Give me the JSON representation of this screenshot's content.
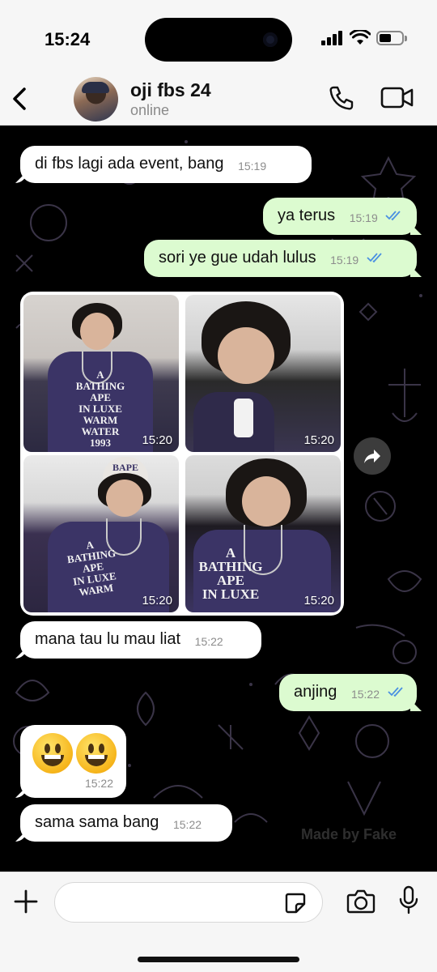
{
  "status_bar": {
    "time": "15:24",
    "battery_percent": 55
  },
  "header": {
    "back_icon": "chevron-left-icon",
    "contact_name": "oji fbs 24",
    "contact_status": "online",
    "call_icon": "phone-icon",
    "video_icon": "video-camera-icon"
  },
  "messages": [
    {
      "dir": "in",
      "text": "di fbs lagi ada event, bang",
      "time": "15:19"
    },
    {
      "dir": "out",
      "text": "ya terus",
      "time": "15:19",
      "read": true
    },
    {
      "dir": "out",
      "text": "sori ye gue udah lulus",
      "time": "15:19",
      "read": true
    },
    {
      "dir": "in",
      "type": "album",
      "photos": [
        {
          "time": "15:20",
          "shirt_text": "A\nBATHING\nAPE\nIN LUXE\nWARM\nWATER\n1993"
        },
        {
          "time": "15:20"
        },
        {
          "time": "15:20",
          "cap_text": "BAPE",
          "shirt_text": "A\nBATHING\nAPE\nIN LUXE\nWARM"
        },
        {
          "time": "15:20",
          "shirt_text": "A\nBATHING\nAPE\nIN LUXE"
        }
      ]
    },
    {
      "dir": "in",
      "text": "mana tau lu mau liat",
      "time": "15:22"
    },
    {
      "dir": "out",
      "text": "anjing",
      "time": "15:22",
      "read": true
    },
    {
      "dir": "in",
      "type": "emoji",
      "emoji": "😃😃",
      "time": "15:22"
    },
    {
      "dir": "in",
      "text": "sama sama bang",
      "time": "15:22"
    }
  ],
  "watermark": "Made by Fake",
  "input_bar": {
    "plus_icon": "plus-icon",
    "message_value": "",
    "sticker_icon": "sticker-icon",
    "camera_icon": "camera-icon",
    "mic_icon": "microphone-icon"
  },
  "colors": {
    "outgoing_bubble": "#dcfbd0",
    "incoming_bubble": "#ffffff",
    "read_tick": "#4a90e2",
    "chat_bg": "#000000"
  }
}
